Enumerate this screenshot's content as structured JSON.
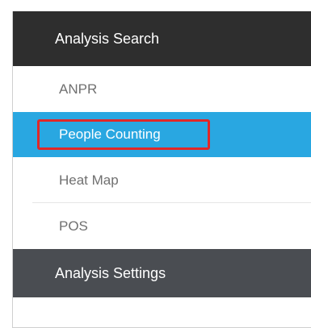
{
  "analysis_search": {
    "header_label": "Analysis Search",
    "items": [
      {
        "label": "ANPR"
      },
      {
        "label": "People Counting",
        "active": true
      },
      {
        "label": "Heat Map"
      },
      {
        "label": "POS"
      }
    ]
  },
  "analysis_settings": {
    "header_label": "Analysis Settings"
  },
  "colors": {
    "header_dark": "#2e2e2e",
    "header_secondary": "#4a4d52",
    "active_item": "#29a7e1",
    "highlight": "#e02828",
    "item_text": "#707070"
  }
}
